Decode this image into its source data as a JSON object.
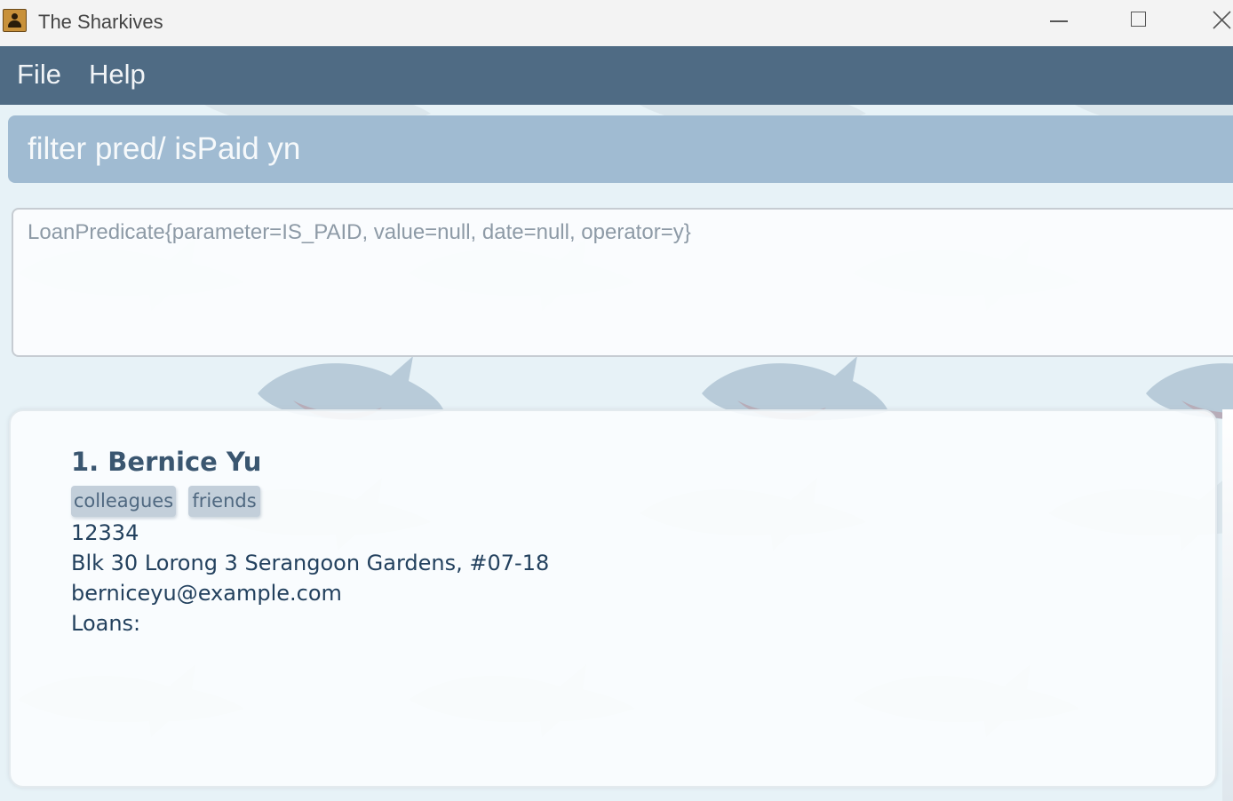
{
  "window": {
    "title": "The Sharkives",
    "icon": "contacts-book-icon"
  },
  "menu": {
    "items": [
      "File",
      "Help"
    ]
  },
  "command": {
    "text": "filter pred/ isPaid yn"
  },
  "result": {
    "text": "LoanPredicate{parameter=IS_PAID, value=null, date=null, operator=y}"
  },
  "person": {
    "index_name": "1.  Bernice Yu",
    "tags": [
      "colleagues",
      "friends"
    ],
    "phone": "12334",
    "address": "Blk 30 Lorong 3 Serangoon Gardens, #07-18",
    "email": "berniceyu@example.com",
    "loans_label": "Loans:"
  },
  "colors": {
    "menubar": "#4f6b84",
    "command_box": "#a0bbd2",
    "background": "#e7f2f7",
    "name_text": "#3a5670"
  }
}
